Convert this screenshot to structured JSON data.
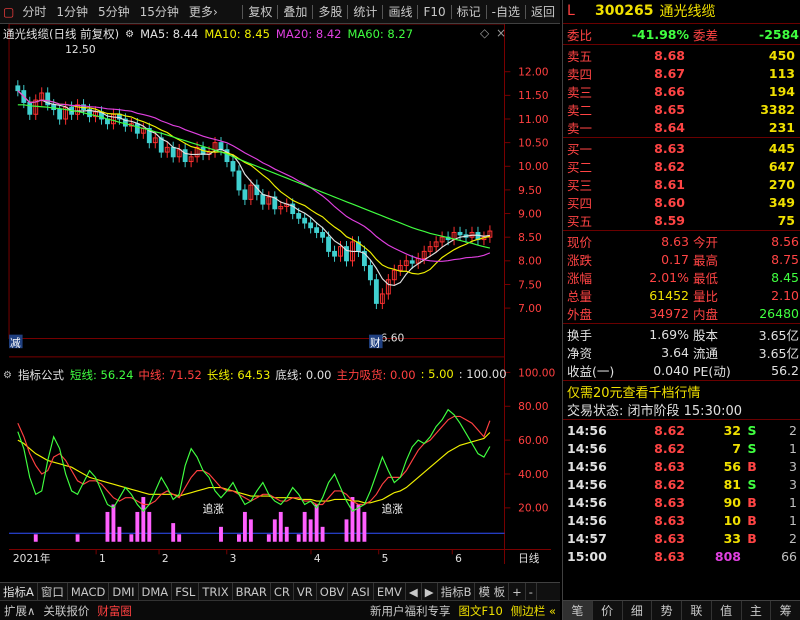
{
  "toolbar": {
    "left": [
      "分时",
      "1分钟",
      "5分钟",
      "15分钟",
      "更多"
    ],
    "more_arrow": "›",
    "right": [
      "复权",
      "叠加",
      "多股",
      "统计",
      "画线",
      "F10",
      "标记",
      "-自选",
      "返回"
    ]
  },
  "main_legend": {
    "title": "通光线缆(日线 前复权)",
    "items": [
      {
        "label": "MA5: 8.44",
        "color": "#e0e0e0"
      },
      {
        "label": "MA10: 8.45",
        "color": "#f0f000"
      },
      {
        "label": "MA20: 8.42",
        "color": "#e040e0"
      },
      {
        "label": "MA60: 8.27",
        "color": "#40ff40"
      }
    ],
    "high_label": "12.50",
    "low_label": "6.60",
    "left_mark": "减",
    "finance_mark": "财"
  },
  "price_axis": [
    "12.00",
    "11.50",
    "11.00",
    "10.50",
    "10.00",
    "9.50",
    "9.00",
    "8.50",
    "8.00",
    "7.50",
    "7.00"
  ],
  "indicator_legend": {
    "title": "指标公式",
    "items": [
      {
        "label": "短线: 56.24",
        "color": "#40ff40"
      },
      {
        "label": "中线: 71.52",
        "color": "#ff4040"
      },
      {
        "label": "长线: 64.53",
        "color": "#f0f000"
      },
      {
        "label": "底线: 0.00",
        "color": "#e0e0e0"
      },
      {
        "label": "主力吸货: 0.00",
        "color": "#ff4040"
      },
      {
        "label": ": 5.00",
        "color": "#f0f000"
      },
      {
        "label": ": 100.00",
        "color": "#e0e0e0"
      },
      {
        "label": "风险",
        "color": "#40ff40"
      }
    ],
    "annot1": "追涨",
    "annot2": "追涨"
  },
  "indicator_axis": [
    "100.00",
    "80.00",
    "60.00",
    "40.00",
    "20.00"
  ],
  "date_axis": {
    "year": "2021年",
    "months": [
      "1",
      "2",
      "3",
      "4",
      "5",
      "6"
    ],
    "right": "日线"
  },
  "tabs": [
    "指标A",
    "窗口",
    "MACD",
    "DMI",
    "DMA",
    "FSL",
    "TRIX",
    "BRAR",
    "CR",
    "VR",
    "OBV",
    "ASI",
    "EMV",
    "◀",
    "▶",
    "指标B",
    "模 板",
    "+",
    "-"
  ],
  "statusbar": {
    "left": [
      "扩展∧",
      "关联报价",
      "财富圈"
    ],
    "right": [
      "新用户福利专享",
      "图文F10",
      "侧边栏 «"
    ]
  },
  "quote": {
    "flag": "L",
    "code": "300265",
    "name": "通光线缆",
    "weibi_label": "委比",
    "weibi": "-41.98%",
    "weicha_label": "委差",
    "weicha": "-2584",
    "sell": [
      {
        "label": "卖五",
        "price": "8.68",
        "vol": "450"
      },
      {
        "label": "卖四",
        "price": "8.67",
        "vol": "113"
      },
      {
        "label": "卖三",
        "price": "8.66",
        "vol": "194"
      },
      {
        "label": "卖二",
        "price": "8.65",
        "vol": "3382"
      },
      {
        "label": "卖一",
        "price": "8.64",
        "vol": "231"
      }
    ],
    "buy": [
      {
        "label": "买一",
        "price": "8.63",
        "vol": "445"
      },
      {
        "label": "买二",
        "price": "8.62",
        "vol": "647"
      },
      {
        "label": "买三",
        "price": "8.61",
        "vol": "270"
      },
      {
        "label": "买四",
        "price": "8.60",
        "vol": "349"
      },
      {
        "label": "买五",
        "price": "8.59",
        "vol": "75"
      }
    ],
    "stats": [
      {
        "k": "现价",
        "v": "8.63",
        "vc": "#ff4444",
        "k2": "今开",
        "v2": "8.56",
        "v2c": "#ff4444"
      },
      {
        "k": "涨跌",
        "v": "0.17",
        "vc": "#ff4444",
        "k2": "最高",
        "v2": "8.75",
        "v2c": "#ff4444"
      },
      {
        "k": "涨幅",
        "v": "2.01%",
        "vc": "#ff4444",
        "k2": "最低",
        "v2": "8.45",
        "v2c": "#40ff40"
      },
      {
        "k": "总量",
        "v": "61452",
        "vc": "#f0e000",
        "k2": "量比",
        "v2": "2.10",
        "v2c": "#ff4444"
      },
      {
        "k": "外盘",
        "v": "34972",
        "vc": "#ff4444",
        "k2": "内盘",
        "v2": "26480",
        "v2c": "#40ff40"
      }
    ],
    "stats2": [
      {
        "k": "换手",
        "v": "1.69%",
        "vc": "#e0e0e0",
        "k2": "股本",
        "v2": "3.65亿",
        "v2c": "#e0e0e0"
      },
      {
        "k": "净资",
        "v": "3.64",
        "vc": "#e0e0e0",
        "k2": "流通",
        "v2": "3.65亿",
        "v2c": "#e0e0e0"
      },
      {
        "k": "收益(一)",
        "v": "0.040",
        "vc": "#e0e0e0",
        "k2": "PE(动)",
        "v2": "56.2",
        "v2c": "#e0e0e0"
      }
    ],
    "promo": "仅需20元查看千档行情",
    "trade_status": "交易状态: 闭市阶段 15:30:00",
    "ticks": [
      {
        "t": "14:56",
        "p": "8.62",
        "n": "32",
        "bs": "S",
        "c": "2"
      },
      {
        "t": "14:56",
        "p": "8.62",
        "n": "7",
        "bs": "S",
        "c": "1"
      },
      {
        "t": "14:56",
        "p": "8.63",
        "n": "56",
        "bs": "B",
        "c": "3"
      },
      {
        "t": "14:56",
        "p": "8.62",
        "n": "81",
        "bs": "S",
        "c": "3"
      },
      {
        "t": "14:56",
        "p": "8.63",
        "n": "90",
        "bs": "B",
        "c": "1"
      },
      {
        "t": "14:56",
        "p": "8.63",
        "n": "10",
        "bs": "B",
        "c": "1"
      },
      {
        "t": "14:57",
        "p": "8.63",
        "n": "33",
        "bs": "B",
        "c": "2"
      },
      {
        "t": "15:00",
        "p": "8.63",
        "n": "808",
        "bs": "",
        "c": "66"
      }
    ],
    "bottom_tabs": [
      "笔",
      "价",
      "细",
      "势",
      "联",
      "值",
      "主",
      "筹"
    ]
  },
  "chart_data": {
    "type": "candlestick",
    "ylim": [
      6.5,
      12.6
    ],
    "close": [
      11.6,
      11.35,
      11.1,
      11.4,
      11.55,
      11.3,
      11.2,
      11.0,
      11.25,
      11.1,
      11.3,
      11.2,
      11.05,
      11.15,
      11.0,
      10.9,
      11.1,
      11.0,
      10.85,
      10.9,
      10.7,
      10.8,
      10.5,
      10.6,
      10.3,
      10.4,
      10.2,
      10.35,
      10.1,
      10.2,
      10.4,
      10.25,
      10.3,
      10.5,
      10.35,
      10.1,
      9.9,
      9.5,
      9.3,
      9.6,
      9.4,
      9.2,
      9.35,
      9.1,
      9.15,
      9.2,
      9.0,
      8.9,
      8.8,
      8.7,
      8.6,
      8.5,
      8.2,
      8.1,
      8.3,
      8.0,
      8.4,
      8.2,
      7.9,
      7.6,
      7.1,
      7.3,
      7.6,
      7.8,
      7.9,
      8.0,
      7.95,
      8.05,
      8.2,
      8.3,
      8.4,
      8.5,
      8.45,
      8.6,
      8.55,
      8.5,
      8.6,
      8.45,
      8.5,
      8.63
    ],
    "ma60": [
      11.3,
      11.3,
      11.28,
      11.27,
      11.26,
      11.25,
      11.23,
      11.22,
      11.2,
      11.18,
      11.16,
      11.13,
      11.1,
      11.07,
      11.04,
      11.0,
      10.97,
      10.93,
      10.9,
      10.87,
      10.83,
      10.8,
      10.77,
      10.73,
      10.7,
      10.66,
      10.62,
      10.58,
      10.54,
      10.5,
      10.46,
      10.42,
      10.38,
      10.34,
      10.3,
      10.26,
      10.2,
      10.15,
      10.1,
      10.05,
      10.0,
      9.95,
      9.9,
      9.85,
      9.8,
      9.75,
      9.7,
      9.65,
      9.6,
      9.55,
      9.5,
      9.45,
      9.4,
      9.35,
      9.3,
      9.25,
      9.2,
      9.15,
      9.1,
      9.05,
      9.0,
      8.95,
      8.9,
      8.85,
      8.8,
      8.75,
      8.7,
      8.66,
      8.62,
      8.58,
      8.55,
      8.52,
      8.49,
      8.46,
      8.43,
      8.4,
      8.37,
      8.33,
      8.3,
      8.27
    ],
    "indicator_short": [
      65,
      55,
      38,
      28,
      30,
      48,
      62,
      55,
      40,
      30,
      28,
      35,
      42,
      38,
      30,
      22,
      20,
      26,
      32,
      28,
      22,
      18,
      22,
      30,
      38,
      32,
      25,
      28,
      45,
      55,
      50,
      42,
      38,
      30,
      26,
      30,
      35,
      28,
      22,
      24,
      30,
      35,
      28,
      24,
      22,
      26,
      32,
      28,
      22,
      24,
      20,
      26,
      35,
      40,
      32,
      24,
      18,
      20,
      22,
      30,
      40,
      50,
      42,
      35,
      38,
      48,
      56,
      60,
      58,
      62,
      68,
      72,
      78,
      75,
      70,
      64,
      58,
      52,
      50,
      56.2
    ],
    "indicator_mid": [
      70,
      62,
      52,
      45,
      40,
      42,
      50,
      52,
      48,
      42,
      36,
      34,
      36,
      36,
      34,
      30,
      26,
      24,
      26,
      26,
      24,
      22,
      22,
      24,
      28,
      30,
      28,
      26,
      32,
      38,
      42,
      42,
      40,
      36,
      32,
      30,
      30,
      28,
      26,
      24,
      26,
      28,
      28,
      26,
      24,
      24,
      26,
      26,
      24,
      24,
      22,
      22,
      26,
      30,
      30,
      28,
      24,
      22,
      22,
      24,
      28,
      34,
      38,
      38,
      38,
      42,
      48,
      54,
      58,
      60,
      64,
      68,
      72,
      74,
      74,
      72,
      70,
      66,
      62,
      71.5
    ],
    "indicator_long": [
      60,
      58,
      55,
      52,
      50,
      48,
      47,
      46,
      45,
      44,
      42,
      40,
      38,
      37,
      36,
      35,
      34,
      33,
      32,
      31,
      30,
      29,
      28,
      28,
      28,
      28,
      28,
      27,
      28,
      29,
      30,
      31,
      32,
      32,
      32,
      31,
      30,
      29,
      28,
      27,
      27,
      27,
      27,
      26,
      26,
      26,
      26,
      25,
      25,
      25,
      24,
      24,
      24,
      25,
      25,
      25,
      24,
      24,
      23,
      23,
      24,
      25,
      27,
      29,
      30,
      32,
      35,
      38,
      41,
      44,
      47,
      50,
      53,
      55,
      57,
      58,
      59,
      60,
      61,
      64.5
    ]
  }
}
